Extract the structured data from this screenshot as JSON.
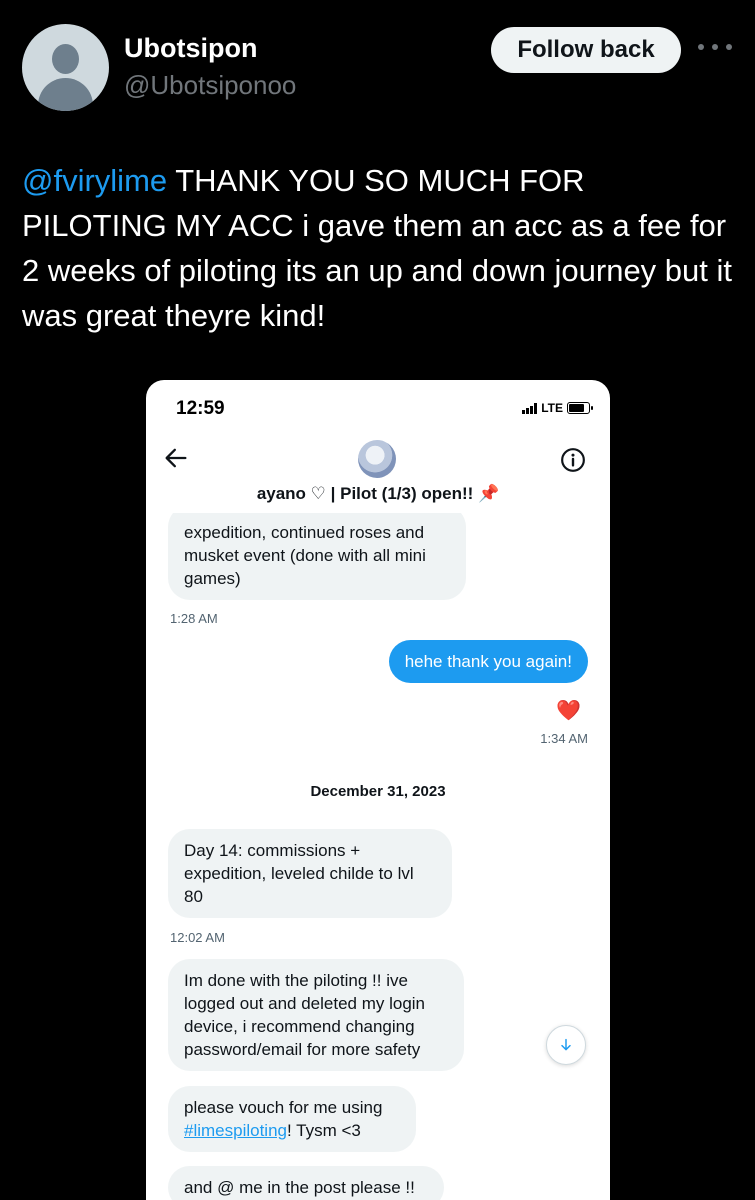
{
  "tweet": {
    "author_name": "Ubotsipon",
    "author_handle": "@Ubotsiponoo",
    "follow_label": "Follow back",
    "mention": "@fvirylime",
    "text": " THANK YOU SO MUCH FOR PILOTING MY ACC i gave them an acc as a fee for 2 weeks of piloting its an up and down journey but it was great theyre kind!"
  },
  "screenshot": {
    "status_time": "12:59",
    "network": "LTE",
    "chat_name": "ayano ♡ | Pilot (1/3) open!! 📌",
    "messages": {
      "m1_text": "expedition, continued roses and musket event (done with all mini games)",
      "m1_time": "1:28 AM",
      "m2_text": "hehe thank you again!",
      "m2_reaction": "❤️",
      "m2_time": "1:34 AM",
      "date_separator": "December 31, 2023",
      "m3_text": "Day 14: commissions + expedition, leveled childe to lvl 80",
      "m3_time": "12:02 AM",
      "m4_text": "Im done with the piloting !! ive logged out and deleted my login device, i recommend changing password/email for more safety",
      "m5_prefix": "please vouch for me using",
      "m5_hashtag": "#limespiloting",
      "m5_suffix": "! Tysm <3",
      "m6_text": "and @ me in the post please !!"
    }
  },
  "colors": {
    "background": "#000000",
    "link": "#1d9bf0",
    "secondary_text": "#71767b",
    "outgoing_bubble": "#1d9bf0",
    "incoming_bubble": "#eff3f4"
  },
  "icons": [
    "more-icon",
    "back-arrow-icon",
    "info-icon",
    "signal-icon",
    "battery-icon",
    "scroll-down-icon",
    "heart-reaction-icon"
  ]
}
